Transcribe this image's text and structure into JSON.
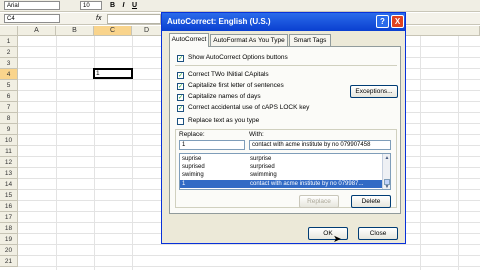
{
  "toolbar": {
    "font_name": "Arial",
    "font_size": "10",
    "bold": "B",
    "italic": "I",
    "underline": "U"
  },
  "formula_bar": {
    "name_box": "C4",
    "fx": "fx"
  },
  "sheet": {
    "columns": [
      "A",
      "B",
      "C",
      "D"
    ],
    "rows": [
      "1",
      "2",
      "3",
      "4",
      "5",
      "6",
      "7",
      "8",
      "9",
      "10",
      "11",
      "12",
      "13",
      "14",
      "15",
      "16",
      "17",
      "18",
      "19",
      "20",
      "21"
    ],
    "active_cell_value": "1"
  },
  "dialog": {
    "title": "AutoCorrect: English (U.S.)",
    "help_btn": "?",
    "close_btn": "X",
    "tabs": [
      "AutoCorrect",
      "AutoFormat As You Type",
      "Smart Tags"
    ],
    "show_buttons": "Show AutoCorrect Options buttons",
    "options": [
      "Correct TWo INitial CApitals",
      "Capitalize first letter of sentences",
      "Capitalize names of days",
      "Correct accidental use of cAPS LOCK key"
    ],
    "exceptions_label": "Exceptions...",
    "replace_text_as_you_type": "Replace text as you type",
    "replace_label": "Replace:",
    "with_label": "With:",
    "replace_value": "1",
    "with_value": "contact with acme institute by no 079907458",
    "entries": [
      {
        "replace": "suprise",
        "with": "surprise"
      },
      {
        "replace": "suprised",
        "with": "surprised"
      },
      {
        "replace": "swiming",
        "with": "swimming"
      },
      {
        "replace": "1",
        "with": "contact with acme institute by no 079987..."
      }
    ],
    "replace_btn": "Replace",
    "delete_btn": "Delete",
    "ok_btn": "OK",
    "close_label": "Close"
  }
}
